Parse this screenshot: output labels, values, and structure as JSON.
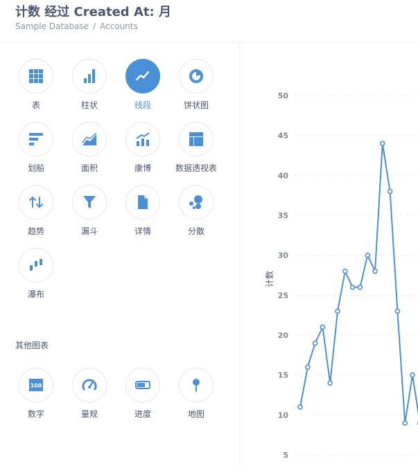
{
  "header": {
    "title": "计数 经过 Created At: 月",
    "breadcrumbs": [
      "Sample Database",
      "Accounts"
    ],
    "separator": "/"
  },
  "colors": {
    "accent": "#4a90d9",
    "text": "#4c5773",
    "muted": "#8b95a5",
    "line": "#4a90d9"
  },
  "viz_types": [
    {
      "label": "表",
      "icon": "table-icon",
      "active": false
    },
    {
      "label": "柱状",
      "icon": "bar-chart-icon",
      "active": false
    },
    {
      "label": "线段",
      "icon": "line-chart-icon",
      "active": true
    },
    {
      "label": "饼状图",
      "icon": "pie-chart-icon",
      "active": false
    },
    {
      "label": "划船",
      "icon": "row-chart-icon",
      "active": false
    },
    {
      "label": "面积",
      "icon": "area-chart-icon",
      "active": false
    },
    {
      "label": "康博",
      "icon": "combo-chart-icon",
      "active": false
    },
    {
      "label": "数据透视表",
      "icon": "pivot-table-icon",
      "active": false
    },
    {
      "label": "趋势",
      "icon": "trend-icon",
      "active": false
    },
    {
      "label": "漏斗",
      "icon": "funnel-icon",
      "active": false
    },
    {
      "label": "详情",
      "icon": "detail-icon",
      "active": false
    },
    {
      "label": "分散",
      "icon": "scatter-icon",
      "active": false
    },
    {
      "label": "瀑布",
      "icon": "waterfall-icon",
      "active": false
    }
  ],
  "other_section": {
    "title": "其他图表",
    "items": [
      {
        "label": "数字",
        "icon": "number-icon",
        "badge": "100"
      },
      {
        "label": "量规",
        "icon": "gauge-icon"
      },
      {
        "label": "进度",
        "icon": "progress-icon"
      },
      {
        "label": "地图",
        "icon": "map-pin-icon"
      }
    ]
  },
  "chart_data": {
    "type": "line",
    "ylabel": "计数",
    "xlabel": "",
    "ylim": [
      5,
      50
    ],
    "yticks": [
      5,
      10,
      15,
      20,
      25,
      30,
      35,
      40,
      45,
      50
    ],
    "grid": true,
    "series": [
      {
        "values": [
          11,
          16,
          19,
          21,
          14,
          23,
          28,
          26,
          26,
          30,
          28,
          44,
          38,
          23,
          9,
          15,
          9
        ]
      }
    ]
  }
}
